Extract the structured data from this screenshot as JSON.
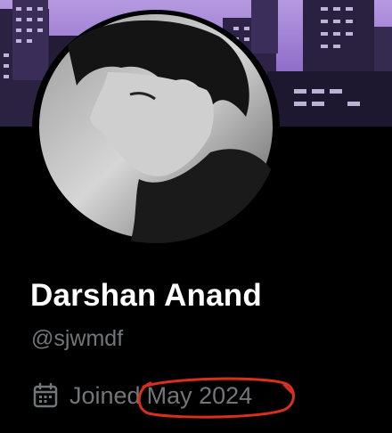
{
  "profile": {
    "display_name": "Darshan Anand",
    "handle": "@sjwmdf",
    "joined_label": "Joined",
    "joined_date": "May 2024"
  },
  "icons": {
    "joined": "calendar-icon"
  },
  "colors": {
    "background": "#000000",
    "name": "#ffffff",
    "secondary_text": "#71767b",
    "highlight_circle": "#d9301e",
    "banner_sky": "#a98ad8"
  }
}
